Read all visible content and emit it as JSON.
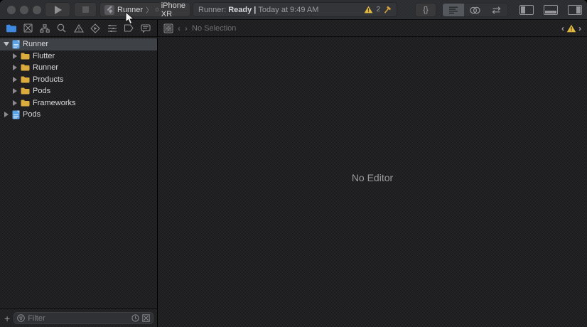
{
  "toolbar": {
    "scheme": {
      "project": "Runner",
      "separator": "〉",
      "device": "iPhone XR"
    },
    "status": {
      "project": "Runner: ",
      "state": "Ready ",
      "divider": "| ",
      "time": "Today at 9:49 AM",
      "warning_count": "2"
    },
    "library_glyph": "{}"
  },
  "jumpbar": {
    "back": "‹",
    "forward": "›",
    "no_selection": "No Selection",
    "issue_back": "‹",
    "issue_forward": "›"
  },
  "navigator": {
    "tabs": [
      {
        "name": "project-navigator",
        "selected": true
      },
      {
        "name": "source-control-navigator",
        "selected": false
      },
      {
        "name": "symbol-navigator",
        "selected": false
      },
      {
        "name": "find-navigator",
        "selected": false
      },
      {
        "name": "issue-navigator",
        "selected": false
      },
      {
        "name": "test-navigator",
        "selected": false
      },
      {
        "name": "debug-navigator",
        "selected": false
      },
      {
        "name": "breakpoint-navigator",
        "selected": false
      },
      {
        "name": "report-navigator",
        "selected": false
      }
    ],
    "tree": [
      {
        "label": "Runner",
        "icon": "xcode-project",
        "level": 0,
        "expanded": true,
        "selected": true
      },
      {
        "label": "Flutter",
        "icon": "folder",
        "level": 1,
        "expanded": false,
        "selected": false
      },
      {
        "label": "Runner",
        "icon": "folder",
        "level": 1,
        "expanded": false,
        "selected": false
      },
      {
        "label": "Products",
        "icon": "folder",
        "level": 1,
        "expanded": false,
        "selected": false
      },
      {
        "label": "Pods",
        "icon": "folder",
        "level": 1,
        "expanded": false,
        "selected": false
      },
      {
        "label": "Frameworks",
        "icon": "folder",
        "level": 1,
        "expanded": false,
        "selected": false
      },
      {
        "label": "Pods",
        "icon": "xcode-project",
        "level": 0,
        "expanded": false,
        "selected": false
      }
    ],
    "filter": {
      "placeholder": "Filter",
      "add_label": "+"
    }
  },
  "editor": {
    "placeholder": "No Editor"
  },
  "colors": {
    "selected_tab_blue": "#3f8ae0",
    "folder_yellow": "#dcab3e",
    "warning_yellow": "#e3b93f",
    "selection_row": "#3e4146",
    "toolbar_bg": "#2d2e30",
    "content_bg": "#1e1e20"
  }
}
